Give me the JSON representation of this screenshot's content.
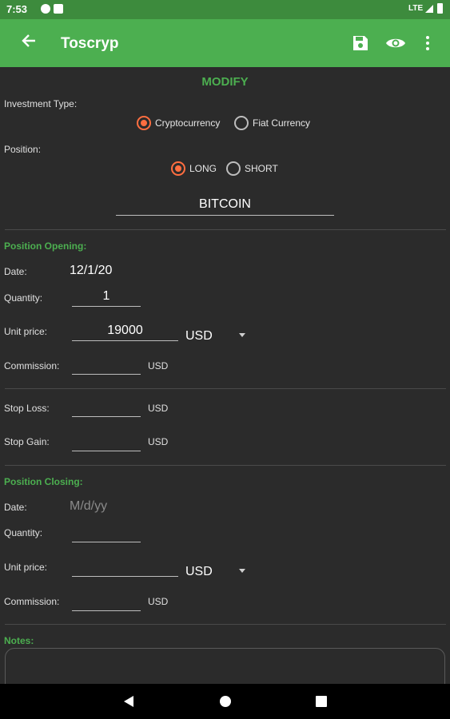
{
  "status_bar": {
    "time": "7:53",
    "network": "LTE"
  },
  "app_bar": {
    "title": "Toscryp"
  },
  "form": {
    "heading": "MODIFY",
    "investment_type_label": "Investment Type:",
    "investment_options": [
      "Cryptocurrency",
      "Fiat Currency"
    ],
    "investment_selected": "Cryptocurrency",
    "position_label": "Position:",
    "position_options": [
      "LONG",
      "SHORT"
    ],
    "position_selected": "LONG",
    "asset_name": "BITCOIN"
  },
  "opening": {
    "title": "Position Opening:",
    "date_label": "Date:",
    "date_value": "12/1/20",
    "quantity_label": "Quantity:",
    "quantity_value": "1",
    "unit_price_label": "Unit price:",
    "unit_price_value": "19000",
    "unit_price_currency": "USD",
    "commission_label": "Commission:",
    "commission_currency": "USD"
  },
  "limits": {
    "stop_loss_label": "Stop Loss:",
    "stop_loss_currency": "USD",
    "stop_gain_label": "Stop Gain:",
    "stop_gain_currency": "USD"
  },
  "closing": {
    "title": "Position Closing:",
    "date_label": "Date:",
    "date_placeholder": "M/d/yy",
    "quantity_label": "Quantity:",
    "unit_price_label": "Unit price:",
    "unit_price_currency": "USD",
    "commission_label": "Commission:",
    "commission_currency": "USD"
  },
  "notes": {
    "title": "Notes:"
  },
  "colors": {
    "primary": "#4caf50",
    "status": "#3d8b3d",
    "accent": "#ff6e40",
    "background": "#2b2b2b"
  }
}
